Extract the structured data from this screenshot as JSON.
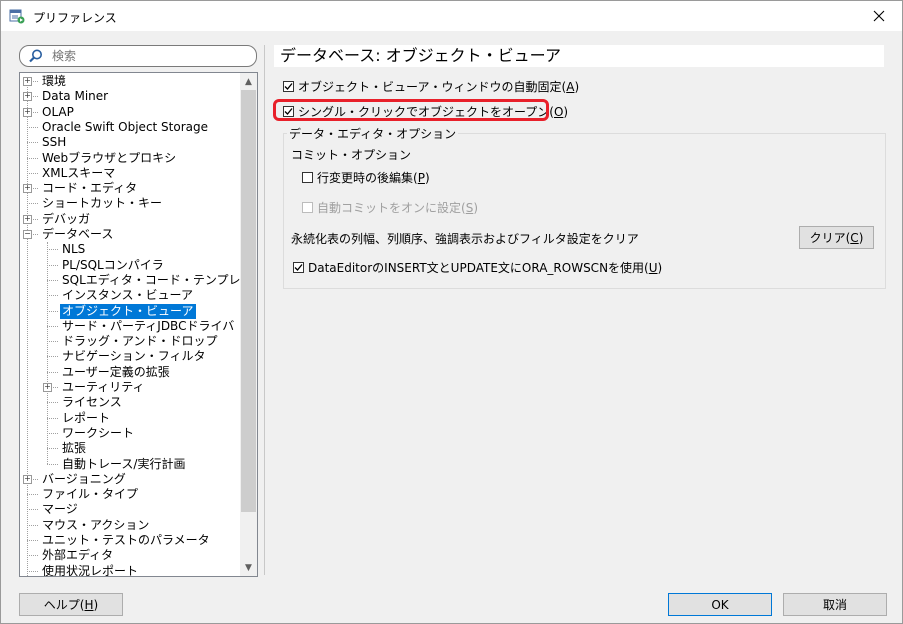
{
  "window": {
    "title": "プリファレンス"
  },
  "search": {
    "placeholder": "検索"
  },
  "tree": {
    "items": [
      {
        "label": "環境",
        "level": 0,
        "expander": "plus"
      },
      {
        "label": "Data Miner",
        "level": 0,
        "expander": "plus"
      },
      {
        "label": "OLAP",
        "level": 0,
        "expander": "plus"
      },
      {
        "label": "Oracle Swift Object Storage",
        "level": 0,
        "expander": "none"
      },
      {
        "label": "SSH",
        "level": 0,
        "expander": "none"
      },
      {
        "label": "Webブラウザとプロキシ",
        "level": 0,
        "expander": "none"
      },
      {
        "label": "XMLスキーマ",
        "level": 0,
        "expander": "none"
      },
      {
        "label": "コード・エディタ",
        "level": 0,
        "expander": "plus"
      },
      {
        "label": "ショートカット・キー",
        "level": 0,
        "expander": "none"
      },
      {
        "label": "デバッガ",
        "level": 0,
        "expander": "plus"
      },
      {
        "label": "データベース",
        "level": 0,
        "expander": "minus"
      },
      {
        "label": "NLS",
        "level": 1,
        "expander": "none"
      },
      {
        "label": "PL/SQLコンパイラ",
        "level": 1,
        "expander": "none"
      },
      {
        "label": "SQLエディタ・コード・テンプレート",
        "level": 1,
        "expander": "none"
      },
      {
        "label": "インスタンス・ビューア",
        "level": 1,
        "expander": "none"
      },
      {
        "label": "オブジェクト・ビューア",
        "level": 1,
        "expander": "none",
        "selected": true
      },
      {
        "label": "サード・パーティJDBCドライバ",
        "level": 1,
        "expander": "none"
      },
      {
        "label": "ドラッグ・アンド・ドロップ",
        "level": 1,
        "expander": "none"
      },
      {
        "label": "ナビゲーション・フィルタ",
        "level": 1,
        "expander": "none"
      },
      {
        "label": "ユーザー定義の拡張",
        "level": 1,
        "expander": "none"
      },
      {
        "label": "ユーティリティ",
        "level": 1,
        "expander": "plus"
      },
      {
        "label": "ライセンス",
        "level": 1,
        "expander": "none"
      },
      {
        "label": "レポート",
        "level": 1,
        "expander": "none"
      },
      {
        "label": "ワークシート",
        "level": 1,
        "expander": "none"
      },
      {
        "label": "拡張",
        "level": 1,
        "expander": "none"
      },
      {
        "label": "自動トレース/実行計画",
        "level": 1,
        "expander": "none"
      },
      {
        "label": "バージョニング",
        "level": 0,
        "expander": "plus"
      },
      {
        "label": "ファイル・タイプ",
        "level": 0,
        "expander": "none"
      },
      {
        "label": "マージ",
        "level": 0,
        "expander": "none"
      },
      {
        "label": "マウス・アクション",
        "level": 0,
        "expander": "none"
      },
      {
        "label": "ユニット・テストのパラメータ",
        "level": 0,
        "expander": "none"
      },
      {
        "label": "外部エディタ",
        "level": 0,
        "expander": "none"
      },
      {
        "label": "使用状況レポート",
        "level": 0,
        "expander": "none"
      }
    ]
  },
  "panel": {
    "title": "データベース: オブジェクト・ビューア",
    "autofreeze": {
      "label": "オブジェクト・ビューア・ウィンドウの自動固定(",
      "key": "A",
      "suffix": ")",
      "checked": true
    },
    "single_click": {
      "label": "シングル・クリックでオブジェクトをオープン(",
      "key": "O",
      "suffix": ")",
      "checked": true
    },
    "group_label": "データ・エディタ・オプション",
    "commit_label": "コミット・オプション",
    "post_edit": {
      "label": "行変更時の後編集(",
      "key": "P",
      "suffix": ")",
      "checked": false
    },
    "auto_commit": {
      "label": "自動コミットをオンに設定(",
      "key": "S",
      "suffix": ")",
      "checked": false,
      "disabled": true
    },
    "persist_label": "永続化表の列幅、列順序、強調表示およびフィルタ設定をクリア",
    "clear_button": {
      "label": "クリア(",
      "key": "C",
      "suffix": ")"
    },
    "rowscn": {
      "label": "DataEditorのINSERT文とUPDATE文にORA_ROWSCNを使用(",
      "key": "U",
      "suffix": ")",
      "checked": true
    }
  },
  "footer": {
    "help": {
      "label": "ヘルプ(",
      "key": "H",
      "suffix": ")"
    },
    "ok": "OK",
    "cancel": "取消"
  }
}
